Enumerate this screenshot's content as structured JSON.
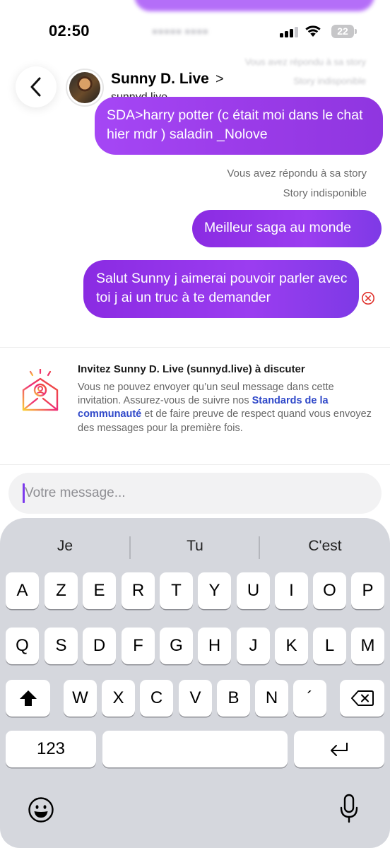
{
  "status_bar": {
    "time": "02:50",
    "battery": "22",
    "signal_bars_active": 3,
    "signal_bars_total": 4
  },
  "header": {
    "contact_name": "Sunny D. Live",
    "chevron": ">",
    "handle": "sunnyd.live",
    "ghost_line_1": "Vous avez répondu à sa story",
    "ghost_line_2": "Story indisponible"
  },
  "messages": [
    {
      "text": "SDA>harry potter (c était moi dans le chat hier mdr ) saladin _Nolove"
    },
    {
      "text": "Meilleur saga au monde"
    },
    {
      "text": "Salut Sunny j aimerai pouvoir parler avec toi j ai un truc à te demander"
    }
  ],
  "meta": {
    "replied_story": "Vous avez répondu à sa story",
    "story_unavailable": "Story indisponible"
  },
  "invite": {
    "title": "Invitez Sunny D. Live (sunnyd.live) à discuter",
    "body_before": "Vous ne pouvez envoyer qu’un seul message dans cette invitation. Assurez-vous de suivre nos ",
    "link": "Standards de la communauté",
    "body_after": " et de faire preuve de respect quand vous envoyez des messages pour la première fois."
  },
  "composer": {
    "placeholder": "Votre message..."
  },
  "keyboard": {
    "suggestions": [
      "Je",
      "Tu",
      "C'est"
    ],
    "row1": [
      "A",
      "Z",
      "E",
      "R",
      "T",
      "Y",
      "U",
      "I",
      "O",
      "P"
    ],
    "row2": [
      "Q",
      "S",
      "D",
      "F",
      "G",
      "H",
      "J",
      "K",
      "L",
      "M"
    ],
    "row3": [
      "W",
      "X",
      "C",
      "V",
      "B",
      "N",
      "´"
    ],
    "numbers_label": "123",
    "icons": {
      "shift": "shift-icon",
      "delete": "backspace-icon",
      "return": "return-icon",
      "emoji": "emoji-icon",
      "dictation": "microphone-icon"
    }
  },
  "colors": {
    "accent": "#9b3df0",
    "link": "#2f48c9",
    "error": "#e0312b"
  }
}
